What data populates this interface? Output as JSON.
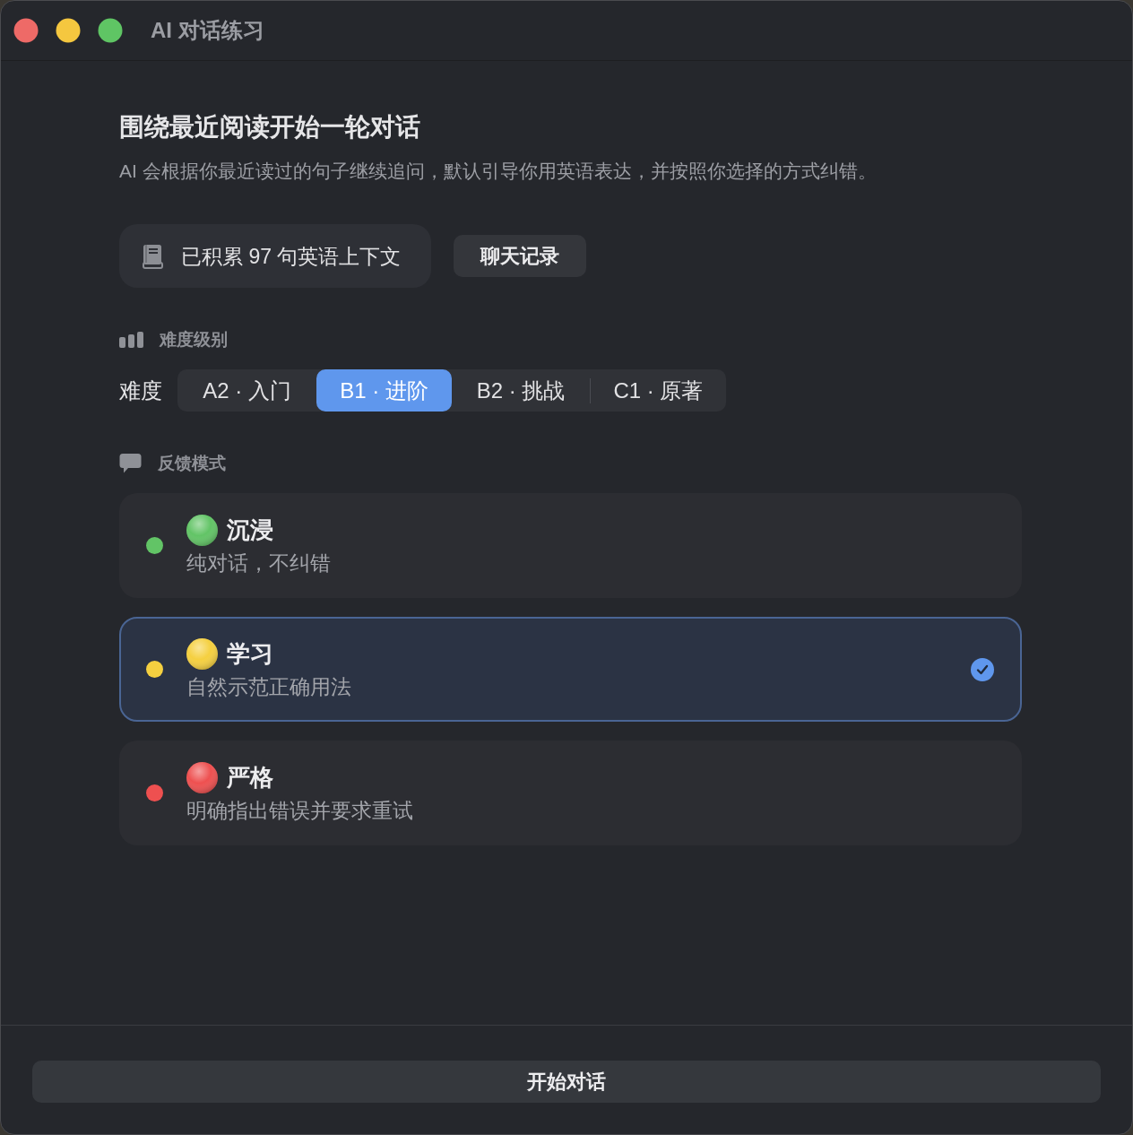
{
  "window": {
    "title": "AI 对话练习"
  },
  "header": {
    "title": "围绕最近阅读开始一轮对话",
    "subtitle": "AI 会根据你最近读过的句子继续追问，默认引导你用英语表达，并按照你选择的方式纠错。"
  },
  "context_badge": {
    "text": "已积累 97 句英语上下文"
  },
  "history_button": {
    "label": "聊天记录"
  },
  "difficulty": {
    "section_title": "难度级别",
    "label": "难度",
    "options": [
      {
        "label": "A2 · 入门",
        "selected": false
      },
      {
        "label": "B1 · 进阶",
        "selected": true
      },
      {
        "label": "B2 · 挑战",
        "selected": false
      },
      {
        "label": "C1 · 原著",
        "selected": false
      }
    ]
  },
  "feedback": {
    "section_title": "反馈模式",
    "modes": [
      {
        "title": "沉浸",
        "description": "纯对话，不纠错",
        "color": "#62c466",
        "selected": false
      },
      {
        "title": "学习",
        "description": "自然示范正确用法",
        "color": "#f5d040",
        "selected": true
      },
      {
        "title": "严格",
        "description": "明确指出错误并要求重试",
        "color": "#ee5050",
        "selected": false
      }
    ]
  },
  "start_button": {
    "label": "开始对话"
  }
}
